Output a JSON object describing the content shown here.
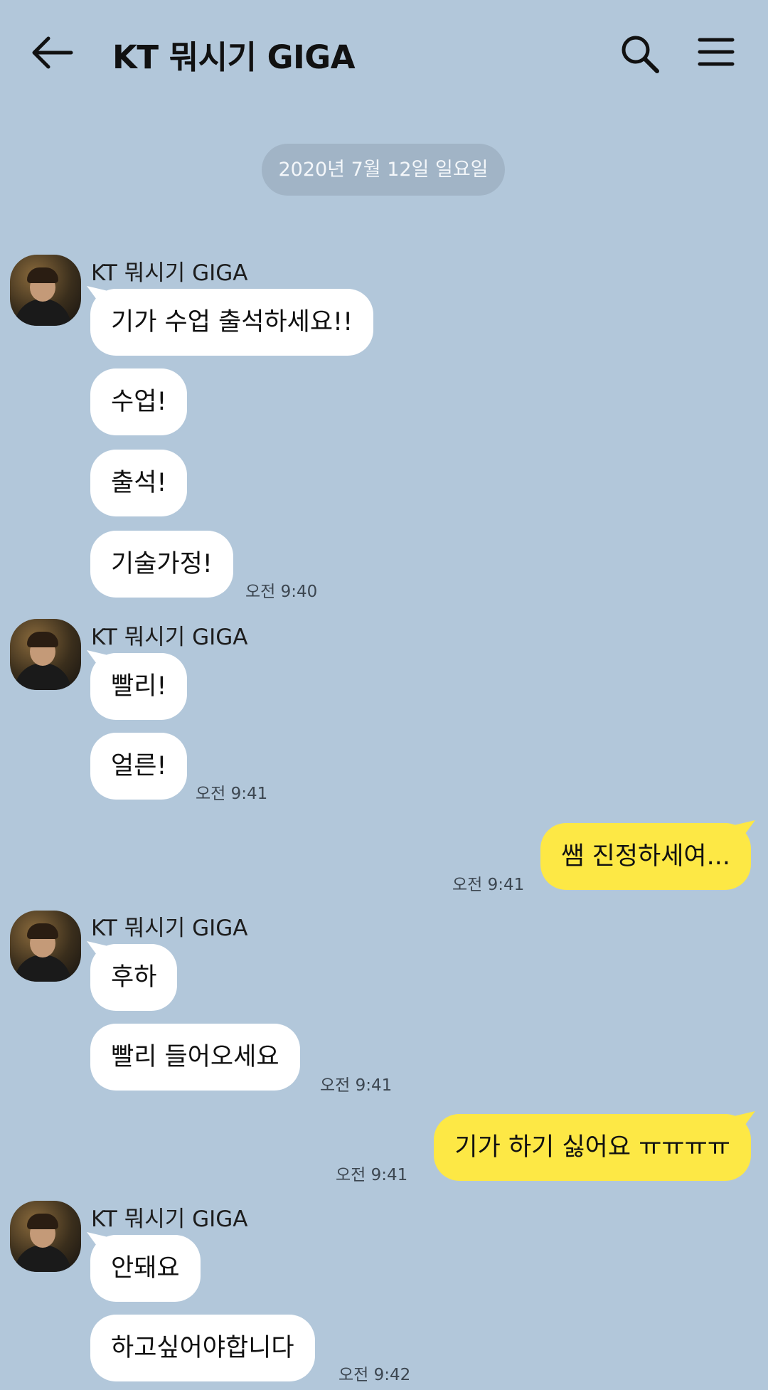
{
  "header": {
    "title": "KT 뭐시기 GIGA",
    "back_icon": "arrow-left-icon",
    "search_icon": "search-icon",
    "menu_icon": "hamburger-menu-icon"
  },
  "date_divider": "2020년 7월 12일 일요일",
  "colors": {
    "background": "#b2c7da",
    "incoming_bubble": "#ffffff",
    "outgoing_bubble": "#fde845",
    "date_pill": "#a1b4c6"
  },
  "groups": [
    {
      "sender": "KT 뭐시기 GIGA",
      "messages": [
        "기가 수업 출석하세요!!",
        "수업!",
        "출석!",
        "기술가정!"
      ],
      "time": "오전 9:40"
    },
    {
      "sender": "KT 뭐시기 GIGA",
      "messages": [
        "빨리!",
        "얼른!"
      ],
      "time": "오전 9:41"
    },
    {
      "outgoing": true,
      "messages": [
        "쌤 진정하세여..."
      ],
      "time": "오전 9:41"
    },
    {
      "sender": "KT 뭐시기 GIGA",
      "messages": [
        "후하",
        "빨리 들어오세요"
      ],
      "time": "오전 9:41"
    },
    {
      "outgoing": true,
      "messages": [
        "기가 하기 싫어요 ㅠㅠㅠㅠ"
      ],
      "time": "오전 9:41"
    },
    {
      "sender": "KT 뭐시기 GIGA",
      "messages": [
        "안돼요",
        "하고싶어야합니다"
      ],
      "time": "오전 9:42"
    }
  ]
}
